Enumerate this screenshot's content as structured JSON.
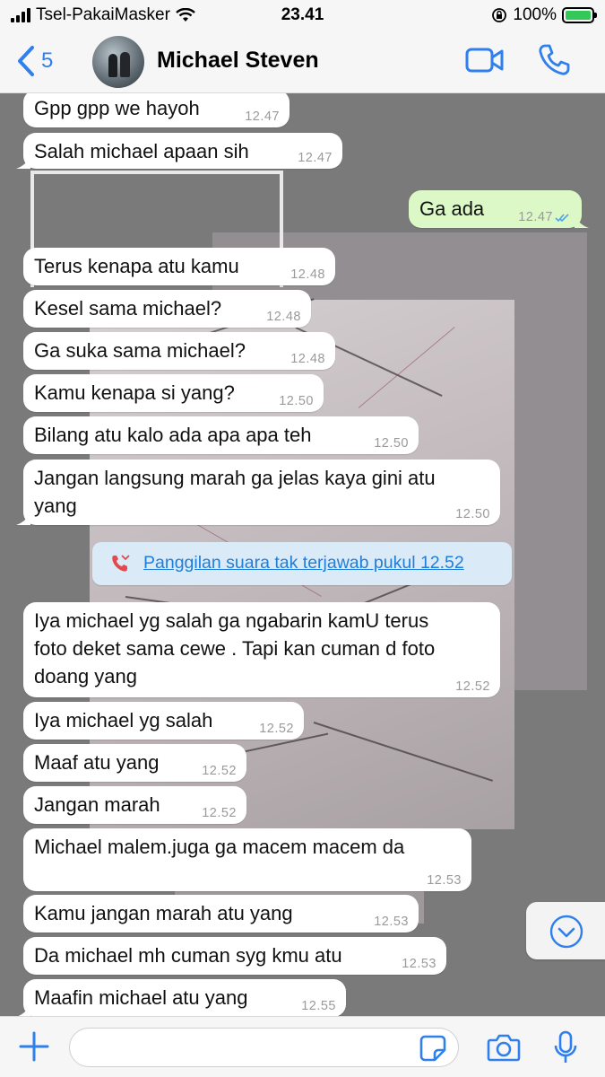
{
  "status_bar": {
    "carrier": "Tsel-PakaiMasker",
    "time": "23.41",
    "battery": "100%"
  },
  "header": {
    "back_count": "5",
    "contact_name": "Michael Steven"
  },
  "messages": [
    {
      "text": "Gpp gpp we hayoh",
      "time": "12.47"
    },
    {
      "text": "Salah michael apaan sih",
      "time": "12.47"
    },
    {
      "text": "Ga ada",
      "time": "12.47"
    },
    {
      "text": "Terus kenapa atu kamu",
      "time": "12.48"
    },
    {
      "text": "Kesel sama michael?",
      "time": "12.48"
    },
    {
      "text": "Ga suka sama michael?",
      "time": "12.48"
    },
    {
      "text": "Kamu kenapa si yang?",
      "time": "12.50"
    },
    {
      "text": "Bilang atu kalo ada apa apa teh",
      "time": "12.50"
    },
    {
      "text": "Jangan langsung marah ga jelas kaya gini atu\nyang",
      "time": "12.50"
    },
    {
      "text": "Iya michael yg salah ga ngabarin kamU terus\nfoto deket sama cewe . Tapi kan cuman d foto\ndoang yang",
      "time": "12.52"
    },
    {
      "text": "Iya michael yg salah",
      "time": "12.52"
    },
    {
      "text": "Maaf atu yang",
      "time": "12.52"
    },
    {
      "text": "Jangan marah",
      "time": "12.52"
    },
    {
      "text": "Michael malem.juga ga macem macem da",
      "time": "12.53"
    },
    {
      "text": "Kamu jangan marah atu yang",
      "time": "12.53"
    },
    {
      "text": "Da michael mh cuman syg kmu atu",
      "time": "12.53"
    },
    {
      "text": "Maafin michael atu yang",
      "time": "12.55"
    }
  ],
  "call_notice": "Panggilan suara tak terjawab pukul 12.52",
  "colors": {
    "accent": "#2f80ed",
    "outgoing_bubble": "#dcf8c6",
    "incoming_bubble": "#ffffff",
    "missed_call": "#e5484d"
  },
  "icons": [
    "back-chevron-icon",
    "video-call-icon",
    "voice-call-icon",
    "missed-call-icon",
    "chevron-down-icon",
    "plus-icon",
    "sticker-icon",
    "camera-icon",
    "microphone-icon"
  ]
}
